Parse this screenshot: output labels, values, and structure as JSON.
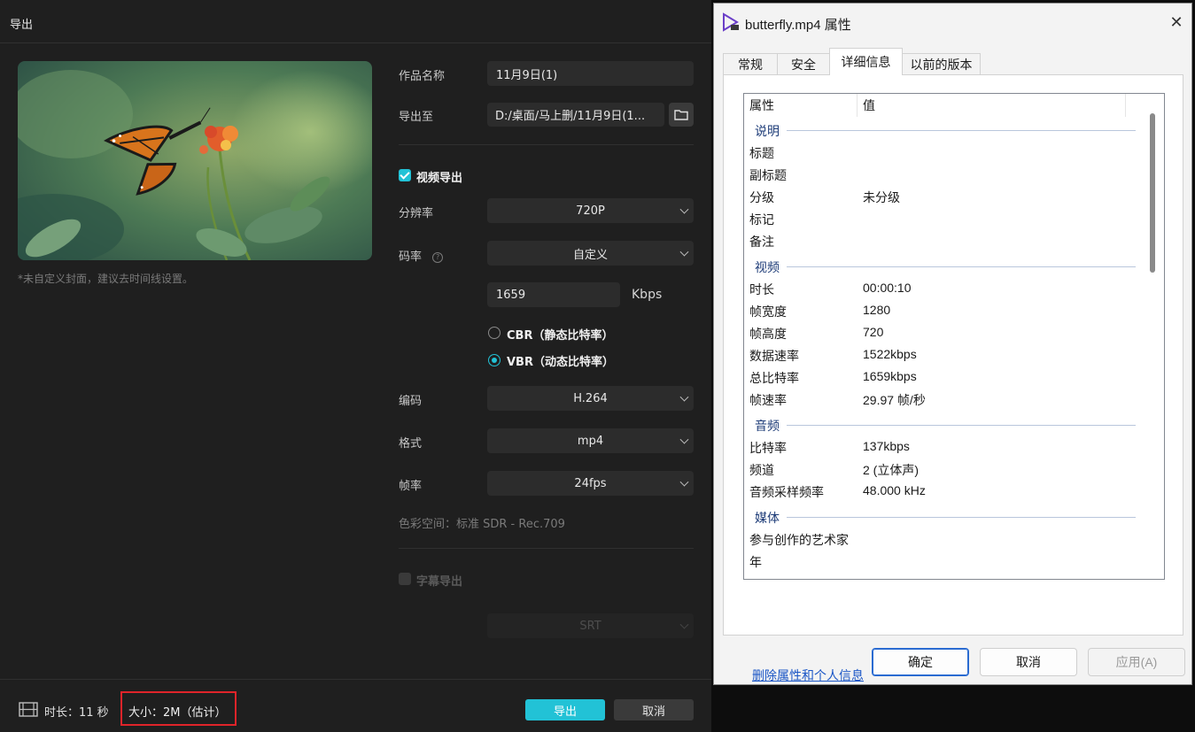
{
  "export_dialog": {
    "title": "导出",
    "cover_note": "*未自定义封面，建议去时间线设置。",
    "work_name": {
      "label": "作品名称",
      "value": "11月9日(1)"
    },
    "export_to": {
      "label": "导出至",
      "value": "D:/桌面/马上删/11月9日(1..."
    },
    "video_export": {
      "label": "视频导出",
      "checked": true
    },
    "resolution": {
      "label": "分辨率",
      "value": "720P"
    },
    "bitrate": {
      "label": "码率",
      "value": "自定义",
      "custom_value": "1659",
      "unit": "Kbps"
    },
    "cbr_label": "CBR（静态比特率）",
    "vbr_label": "VBR（动态比特率）",
    "rate_mode": "VBR",
    "codec": {
      "label": "编码",
      "value": "H.264"
    },
    "format": {
      "label": "格式",
      "value": "mp4"
    },
    "framerate": {
      "label": "帧率",
      "value": "24fps"
    },
    "color_space": "色彩空间：标准 SDR - Rec.709",
    "subtitle_export": {
      "label": "字幕导出",
      "checked": false
    },
    "subtitle_format": {
      "value": "SRT"
    },
    "duration": "时长：11 秒",
    "size": "大小：2M（估计）",
    "export_button": "导出",
    "cancel_button": "取消",
    "accent_color": "#22c2d6"
  },
  "properties_window": {
    "title": "butterfly.mp4 属性",
    "tabs": [
      "常规",
      "安全",
      "详细信息",
      "以前的版本"
    ],
    "active_tab": "详细信息",
    "header": {
      "property": "属性",
      "value": "值"
    },
    "sections": [
      {
        "name": "说明",
        "rows": [
          {
            "k": "标题",
            "v": ""
          },
          {
            "k": "副标题",
            "v": ""
          },
          {
            "k": "分级",
            "v": "未分级"
          },
          {
            "k": "标记",
            "v": ""
          },
          {
            "k": "备注",
            "v": ""
          }
        ]
      },
      {
        "name": "视频",
        "rows": [
          {
            "k": "时长",
            "v": "00:00:10"
          },
          {
            "k": "帧宽度",
            "v": "1280"
          },
          {
            "k": "帧高度",
            "v": "720"
          },
          {
            "k": "数据速率",
            "v": "1522kbps"
          },
          {
            "k": "总比特率",
            "v": "1659kbps"
          },
          {
            "k": "帧速率",
            "v": "29.97 帧/秒"
          }
        ]
      },
      {
        "name": "音频",
        "rows": [
          {
            "k": "比特率",
            "v": "137kbps"
          },
          {
            "k": "频道",
            "v": "2 (立体声)"
          },
          {
            "k": "音频采样频率",
            "v": "48.000 kHz"
          }
        ]
      },
      {
        "name": "媒体",
        "rows": [
          {
            "k": "参与创作的艺术家",
            "v": ""
          },
          {
            "k": "年",
            "v": ""
          }
        ]
      }
    ],
    "remove_link": "删除属性和个人信息",
    "ok_button": "确定",
    "cancel_button": "取消",
    "apply_button": "应用(A)"
  }
}
